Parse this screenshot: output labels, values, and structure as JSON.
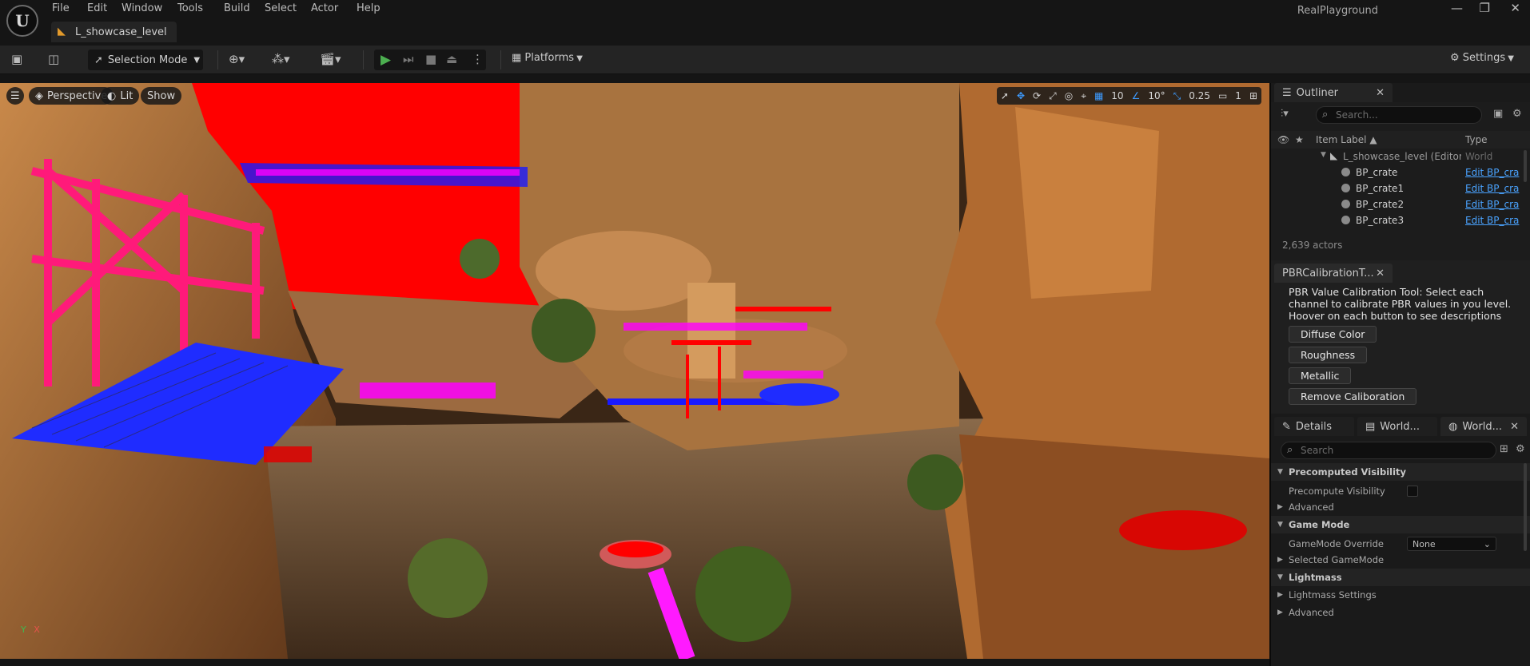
{
  "app": {
    "logo": "U",
    "project_name": "RealPlayground",
    "menu": [
      "File",
      "Edit",
      "Window",
      "Tools",
      "Build",
      "Select",
      "Actor",
      "Help"
    ],
    "level_tab": "L_showcase_level",
    "window_controls": {
      "minimize": "—",
      "maximize": "❐",
      "close": "✕"
    }
  },
  "toolbar": {
    "selection_mode": "Selection Mode",
    "platforms": "Platforms",
    "settings": "Settings"
  },
  "viewport": {
    "perspective": "Perspective",
    "lit": "Lit",
    "show": "Show",
    "grid_snap": "10",
    "rotation_snap": "10°",
    "scale_snap": "0.25",
    "camera_speed": "1",
    "axis_y": "Y",
    "axis_x": "X"
  },
  "outliner": {
    "tab_label": "Outliner",
    "search_placeholder": "Search...",
    "col_item_label": "Item Label ▲",
    "col_type": "Type",
    "rows": [
      {
        "label": "L_showcase_level (Editor)",
        "type": "World"
      },
      {
        "label": "BP_crate",
        "type": "Edit BP_cra"
      },
      {
        "label": "BP_crate1",
        "type": "Edit BP_cra"
      },
      {
        "label": "BP_crate2",
        "type": "Edit BP_cra"
      },
      {
        "label": "BP_crate3",
        "type": "Edit BP_cra"
      }
    ],
    "actor_count": "2,639 actors"
  },
  "pbr_tool": {
    "tab_label": "PBRCalibrationT...",
    "description": "PBR Value Calibration Tool: Select each channel to calibrate PBR values in you level. Hoover on each button to see descriptions",
    "buttons": [
      "Diffuse Color",
      "Roughness",
      "Metallic",
      "Remove Caliboration"
    ]
  },
  "details": {
    "tabs": [
      "Details",
      "World...",
      "World..."
    ],
    "search_placeholder": "Search",
    "categories": {
      "precomputed_visibility": "Precomputed Visibility",
      "precompute_visibility": "Precompute Visibility",
      "advanced1": "Advanced",
      "game_mode": "Game Mode",
      "gamemode_override": "GameMode Override",
      "gamemode_override_value": "None",
      "selected_gamemode": "Selected GameMode",
      "lightmass": "Lightmass",
      "lightmass_settings": "Lightmass Settings",
      "advanced2": "Advanced"
    }
  },
  "colors": {
    "bg_dark": "#151515",
    "panel": "#1a1a1a",
    "accent_blue": "#3d9bff",
    "play_green": "#4caf50",
    "debug_red": "#ff0000",
    "debug_magenta": "#ff00ff",
    "debug_blue": "#1a1aff"
  }
}
